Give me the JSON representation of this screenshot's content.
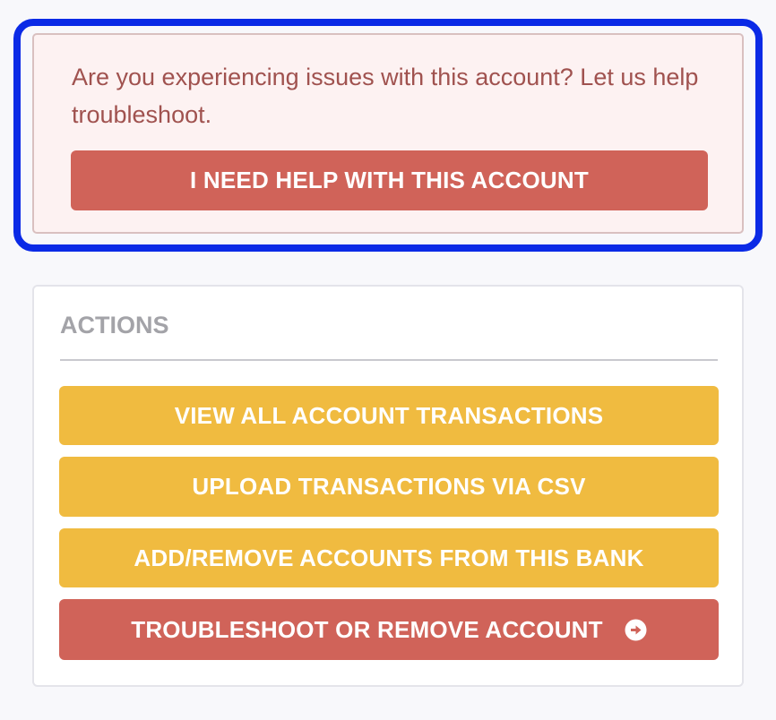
{
  "help_box": {
    "message": "Are you experiencing issues with this account? Let us help troubleshoot.",
    "button_label": "I NEED HELP WITH THIS ACCOUNT"
  },
  "actions": {
    "title": "ACTIONS",
    "view_transactions_label": "VIEW ALL ACCOUNT TRANSACTIONS",
    "upload_csv_label": "UPLOAD TRANSACTIONS VIA CSV",
    "add_remove_accounts_label": "ADD/REMOVE ACCOUNTS FROM THIS BANK",
    "troubleshoot_label": "TROUBLESHOOT OR REMOVE ACCOUNT",
    "troubleshoot_icon": "arrow-circle-right-icon"
  },
  "colors": {
    "highlight_frame": "#0b2ae6",
    "help_background": "#fdf2f2",
    "help_text": "#a0524f",
    "danger_button": "#d06359",
    "action_button": "#f0bb40",
    "section_title": "#a3a3a8"
  }
}
